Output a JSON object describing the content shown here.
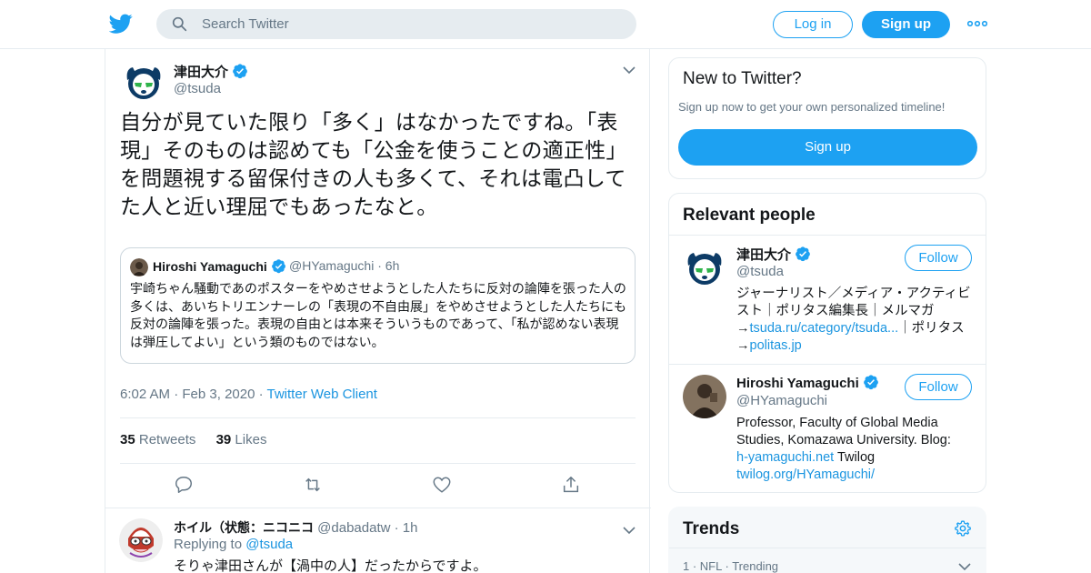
{
  "topbar": {
    "search_placeholder": "Search Twitter",
    "login_label": "Log in",
    "signup_label": "Sign up",
    "accent_color": "#1da1f2"
  },
  "tweet": {
    "author_name": "津田大介",
    "author_handle": "@tsuda",
    "text": "自分が見ていた限り「多く」はなかったですね。「表現」そのものは認めても「公金を使うことの適正性」を問題視する留保付きの人も多くて、それは電凸してた人と近い理屈でもあったなと。",
    "quote": {
      "name": "Hiroshi Yamaguchi",
      "handle": "@HYamaguchi",
      "age": "6h",
      "text": "宇崎ちゃん騒動であのポスターをやめさせようとした人たちに反対の論陣を張った人の多くは、あいちトリエンナーレの「表現の不自由展」をやめさせようとした人たちにも反対の論陣を張った。表現の自由とは本来そういうものであって、「私が認めない表現は弾圧してよい」という類のものではない。"
    },
    "time": "6:02 AM",
    "date": "Feb 3, 2020",
    "source": "Twitter Web Client",
    "retweets_count": "35",
    "retweets_label": "Retweets",
    "likes_count": "39",
    "likes_label": "Likes"
  },
  "reply": {
    "name": "ホイル（状態：ニコニコ",
    "handle": "@dabadatw",
    "age": "1h",
    "replying_label": "Replying to",
    "replying_handle": "@tsuda",
    "text": "そりゃ津田さんが【渦中の人】だったからですよ。"
  },
  "sidebar": {
    "new_title": "New to Twitter?",
    "new_sub": "Sign up now to get your own personalized timeline!",
    "new_signup": "Sign up",
    "people_title": "Relevant people",
    "people": [
      {
        "name": "津田大介",
        "handle": "@tsuda",
        "follow_label": "Follow",
        "bio_1": "ジャーナリスト／メディア・アクティビスト｜ポリタス編集長｜メルマガ",
        "bio_arrow_1": "→",
        "bio_link_1": "tsuda.ru/category/tsuda...",
        "bio_mid": "｜ポリタス",
        "bio_arrow_2": "→",
        "bio_link_2": "politas.jp"
      },
      {
        "name": "Hiroshi Yamaguchi",
        "handle": "@HYamaguchi",
        "follow_label": "Follow",
        "bio_1": "Professor, Faculty of Global Media Studies, Komazawa University. Blog:",
        "bio_link_1": "h-yamaguchi.net",
        "bio_mid": "Twilog",
        "bio_link_2": "twilog.org/HYamaguchi/"
      }
    ],
    "trends_title": "Trends",
    "trend_1_rank": "1",
    "trend_1_category": "NFL",
    "trend_1_status": "Trending"
  }
}
